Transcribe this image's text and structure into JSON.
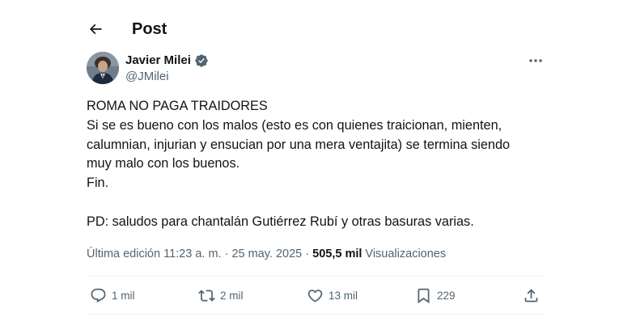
{
  "header": {
    "title": "Post",
    "back_icon": "arrow-left-icon"
  },
  "author": {
    "name": "Javier Milei",
    "handle": "@JMilei",
    "verified_icon": "verified-badge-icon",
    "verified_color": "#536471"
  },
  "post": {
    "lines": [
      "ROMA NO PAGA TRAIDORES",
      "Si se es bueno con los malos (esto es con quienes traicionan, mienten,",
      "calumnian, injurian y ensucian por una mera ventajita) se termina siendo",
      "muy malo con los buenos.",
      "Fin.",
      "",
      "PD: saludos para chantalán Gutiérrez Rubí y otras basuras varias."
    ]
  },
  "meta": {
    "edited_label": "Última edición 11:23 a. m. · 25 may. 2025 · ",
    "views_count": "505,5 mil",
    "views_label": "Visualizaciones"
  },
  "actions": {
    "replies": "1 mil",
    "reposts": "2 mil",
    "likes": "13 mil",
    "bookmarks": "229"
  },
  "colors": {
    "text": "#0f1419",
    "secondary": "#536471",
    "divider": "#eff3f4"
  }
}
